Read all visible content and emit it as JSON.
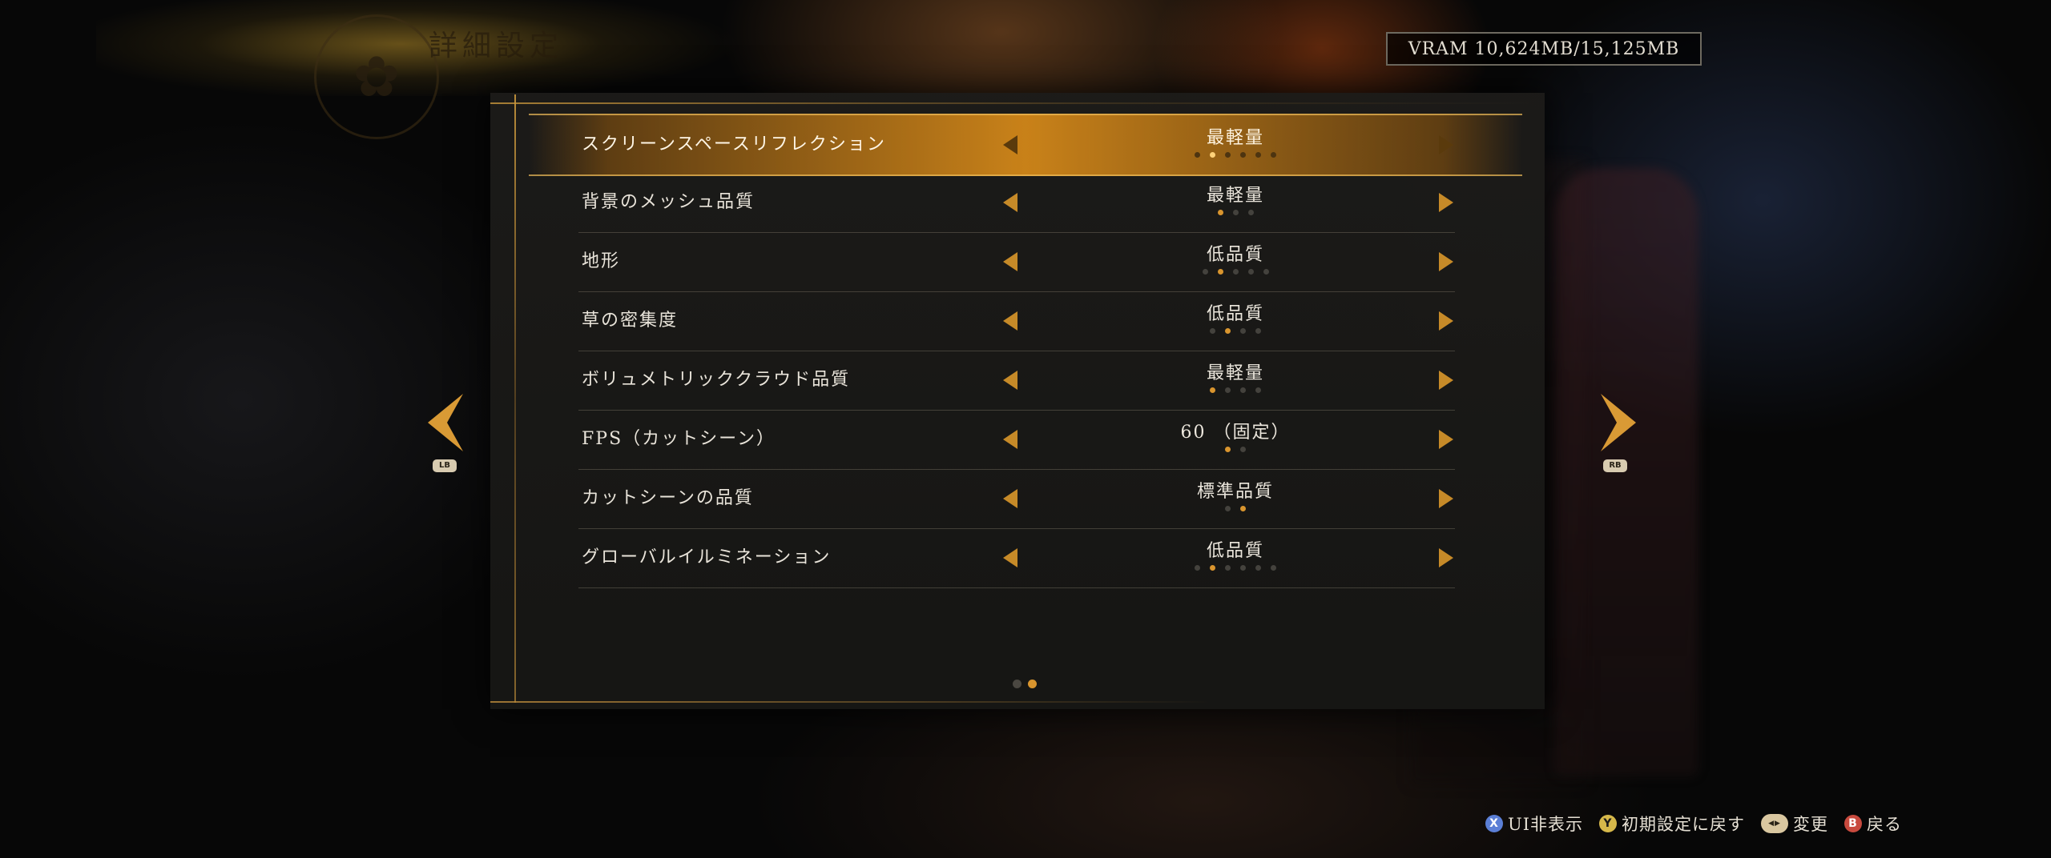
{
  "header": {
    "title": "詳細設定",
    "vram": "VRAM 10,624MB/15,125MB"
  },
  "nav": {
    "prev_badge": "LB",
    "next_badge": "RB"
  },
  "settings": [
    {
      "label": "スクリーンスペースリフレクション",
      "value": "最軽量",
      "level": 2,
      "total": 6,
      "selected": true
    },
    {
      "label": "背景のメッシュ品質",
      "value": "最軽量",
      "level": 1,
      "total": 3,
      "selected": false
    },
    {
      "label": "地形",
      "value": "低品質",
      "level": 2,
      "total": 5,
      "selected": false
    },
    {
      "label": "草の密集度",
      "value": "低品質",
      "level": 2,
      "total": 4,
      "selected": false
    },
    {
      "label": "ボリュメトリッククラウド品質",
      "value": "最軽量",
      "level": 1,
      "total": 4,
      "selected": false
    },
    {
      "label": "FPS（カットシーン）",
      "value": "60 （固定）",
      "level": 1,
      "total": 2,
      "selected": false
    },
    {
      "label": "カットシーンの品質",
      "value": "標準品質",
      "level": 2,
      "total": 2,
      "selected": false
    },
    {
      "label": "グローバルイルミネーション",
      "value": "低品質",
      "level": 2,
      "total": 6,
      "selected": false
    }
  ],
  "pagination": {
    "current": 2,
    "total": 2
  },
  "footer": {
    "hide_ui": {
      "button": "X",
      "label": "UI非表示"
    },
    "reset": {
      "button": "Y",
      "label": "初期設定に戻す"
    },
    "change": {
      "button": "◀▶",
      "label": "変更"
    },
    "back": {
      "button": "B",
      "label": "戻る"
    }
  },
  "colors": {
    "accent": "#d9952e",
    "selected_row": "#d28719",
    "panel": "#1c1b19"
  }
}
